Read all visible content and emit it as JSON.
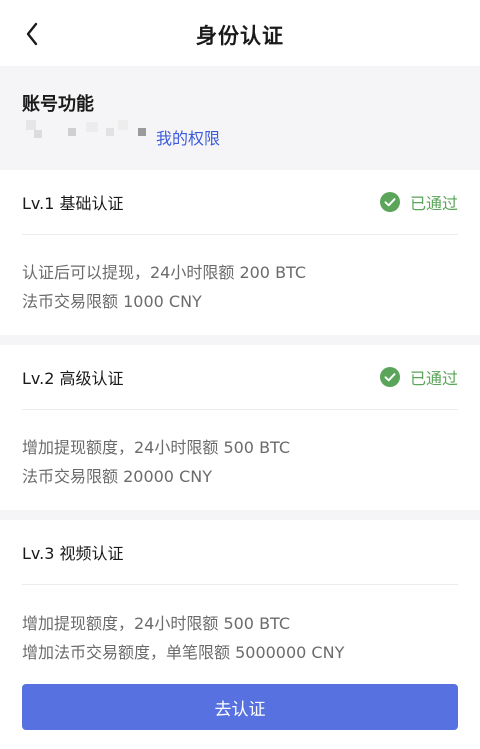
{
  "header": {
    "title": "身份认证"
  },
  "account": {
    "title": "账号功能",
    "permissions_link": "我的权限"
  },
  "levels": [
    {
      "name": "Lv.1 基础认证",
      "status": "已通过",
      "lines": [
        "认证后可以提现，24小时限额 200 BTC",
        "法币交易限额 1000 CNY"
      ]
    },
    {
      "name": "Lv.2 高级认证",
      "status": "已通过",
      "lines": [
        "增加提现额度，24小时限额 500 BTC",
        "法币交易限额 20000 CNY"
      ]
    },
    {
      "name": "Lv.3 视频认证",
      "lines": [
        "增加提现额度，24小时限额 500 BTC",
        "增加法币交易额度，单笔限额 5000000 CNY"
      ]
    }
  ],
  "button": {
    "label": "去认证"
  },
  "colors": {
    "accent": "#5771e0",
    "link": "#3d5bd9",
    "success": "#5aa55a"
  }
}
